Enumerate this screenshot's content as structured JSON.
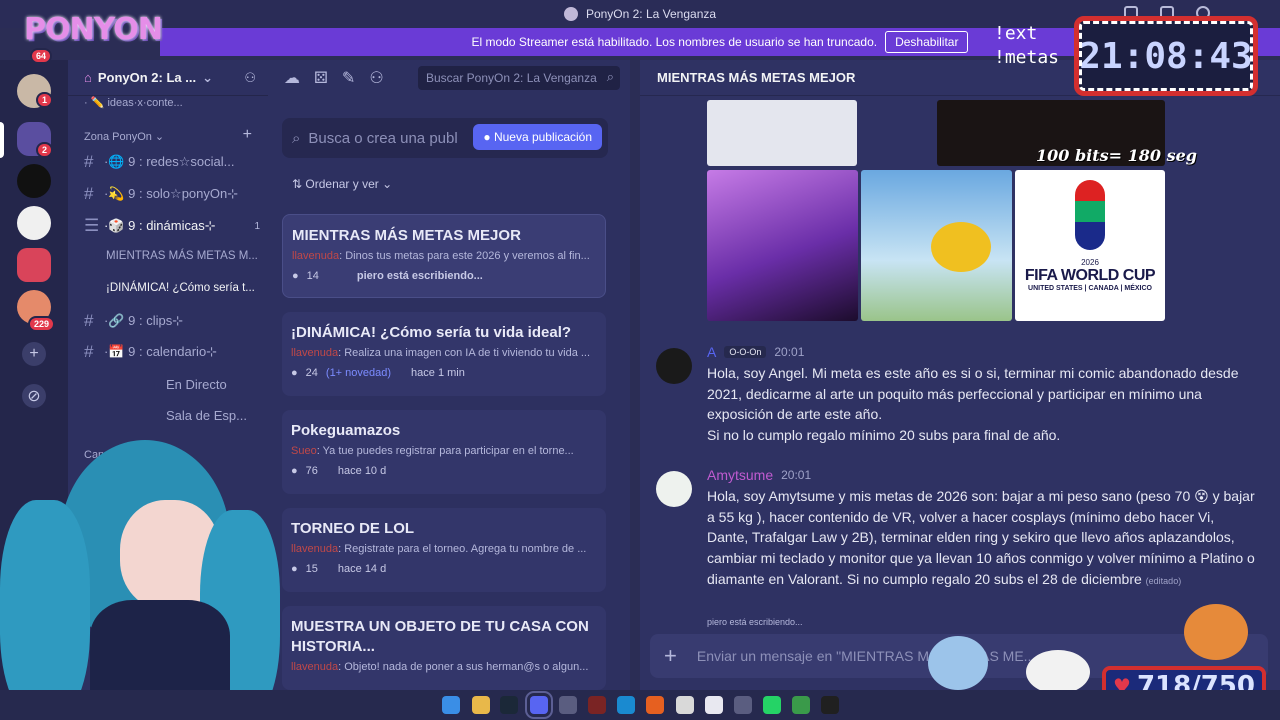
{
  "window": {
    "title": "PonyOn 2: La Venganza"
  },
  "logo": {
    "text": "PONYON"
  },
  "banner": {
    "message": "El modo Streamer está habilitado. Los nombres de usuario se han truncado.",
    "button": "Deshabilitar"
  },
  "rail": {
    "badges": [
      "64",
      "1",
      "2",
      "229"
    ]
  },
  "server": {
    "name": "PonyOn 2: La ...",
    "top_partial": "· ✏️ ideas·x·conte...",
    "category_1": "Zona PonyOn",
    "category_2": "Can",
    "channels": [
      {
        "label": "·🌐 9 : redes☆social..."
      },
      {
        "label": "·💫 9 : solo☆ponyOn⊹"
      },
      {
        "label": "·🎲 9 : dinámicas⊹",
        "count": "1"
      },
      {
        "label": "·🔗 9 : clips⊹"
      },
      {
        "label": "·📅 9 : calendario⊹"
      },
      {
        "label": "En Directo"
      },
      {
        "label": "Sala de Esp..."
      }
    ],
    "threads": [
      "MIENTRAS MÁS METAS M...",
      "¡DINÁMICA! ¿Cómo sería t..."
    ]
  },
  "forum": {
    "search_placeholder": "Buscar PonyOn 2: La Venganza",
    "post_search_placeholder": "Busca o crea una publ",
    "new_post": "Nueva publicación",
    "sort": "Ordenar y ver",
    "posts": [
      {
        "title": "MIENTRAS MÁS METAS MEJOR",
        "author": "llavenuda",
        "preview": "Dinos tus metas para este 2026 y veremos al fin...",
        "count": "14",
        "typing": "piero está escribiendo..."
      },
      {
        "title": "¡DINÁMICA! ¿Cómo sería tu vida ideal?",
        "author": "llavenuda",
        "preview": "Realiza una imagen con IA de ti viviendo tu vida ...",
        "count": "24",
        "new": "(1+ novedad)",
        "time": "hace 1 min"
      },
      {
        "title": "Pokeguamazos",
        "author": "Sueo",
        "preview": "Ya tue puedes registrar para participar en el torne...",
        "count": "76",
        "time": "hace 10 d"
      },
      {
        "title": "TORNEO DE LOL",
        "author": "llavenuda",
        "preview": "Registrate para el torneo. Agrega tu nombre de ...",
        "count": "15",
        "time": "hace 14 d"
      },
      {
        "title": "MUESTRA UN OBJETO DE TU CASA CON HISTORIA...",
        "author": "llavenuda",
        "preview": "Objeto! nada de poner a sus herman@s o algun..."
      }
    ]
  },
  "thread": {
    "title": "MIENTRAS MÁS METAS MEJOR",
    "images": [
      {
        "caption_lines": [
          "2026",
          "FIFA WORLD CUP",
          "UNITED STATES | CANADA | MÉXICO"
        ]
      }
    ],
    "messages": [
      {
        "name": "A",
        "tag": "O-O-On",
        "time": "20:01",
        "text": "Hola, soy Angel. Mi meta es este año es si o si, terminar mi comic abandonado desde 2021, dedicarme al arte un poquito más perfeccional y participar en mínimo una exposición de arte este año.",
        "text2": "Si no lo cumplo regalo mínimo 20 subs para final de año."
      },
      {
        "name": "Amytsume",
        "time": "20:01",
        "text": "Hola, soy Amytsume y mis metas de 2026 son: bajar a mi peso sano (peso 70 😵 y bajar a 55 kg ), hacer contenido de VR, volver a hacer cosplays (mínimo debo hacer Vi, Dante, Trafalgar Law y 2B), terminar elden ring y sekiro que llevo años aplazandolos, cambiar mi teclado y monitor que ya llevan 10 años conmigo y volver mínimo a Platino o diamante en Valorant.  Si no cumplo regalo 20 subs el 28 de diciembre",
        "edited": "(editado)"
      }
    ],
    "typing": "piero está escribiendo...",
    "composer_placeholder": "Enviar un mensaje en \"MIENTRAS MÁS METAS ME..."
  },
  "overlay": {
    "commands": [
      "!ext",
      "!metas"
    ],
    "clock": "21:08:43",
    "bits_note": "100 bits= 180 seg",
    "counter": "718/750"
  },
  "colors": {
    "accent": "#5865f2",
    "banner": "#6a3bd6",
    "author": "#c04848",
    "amytsume": "#c05bd0",
    "counter_border": "#d32f2f"
  }
}
